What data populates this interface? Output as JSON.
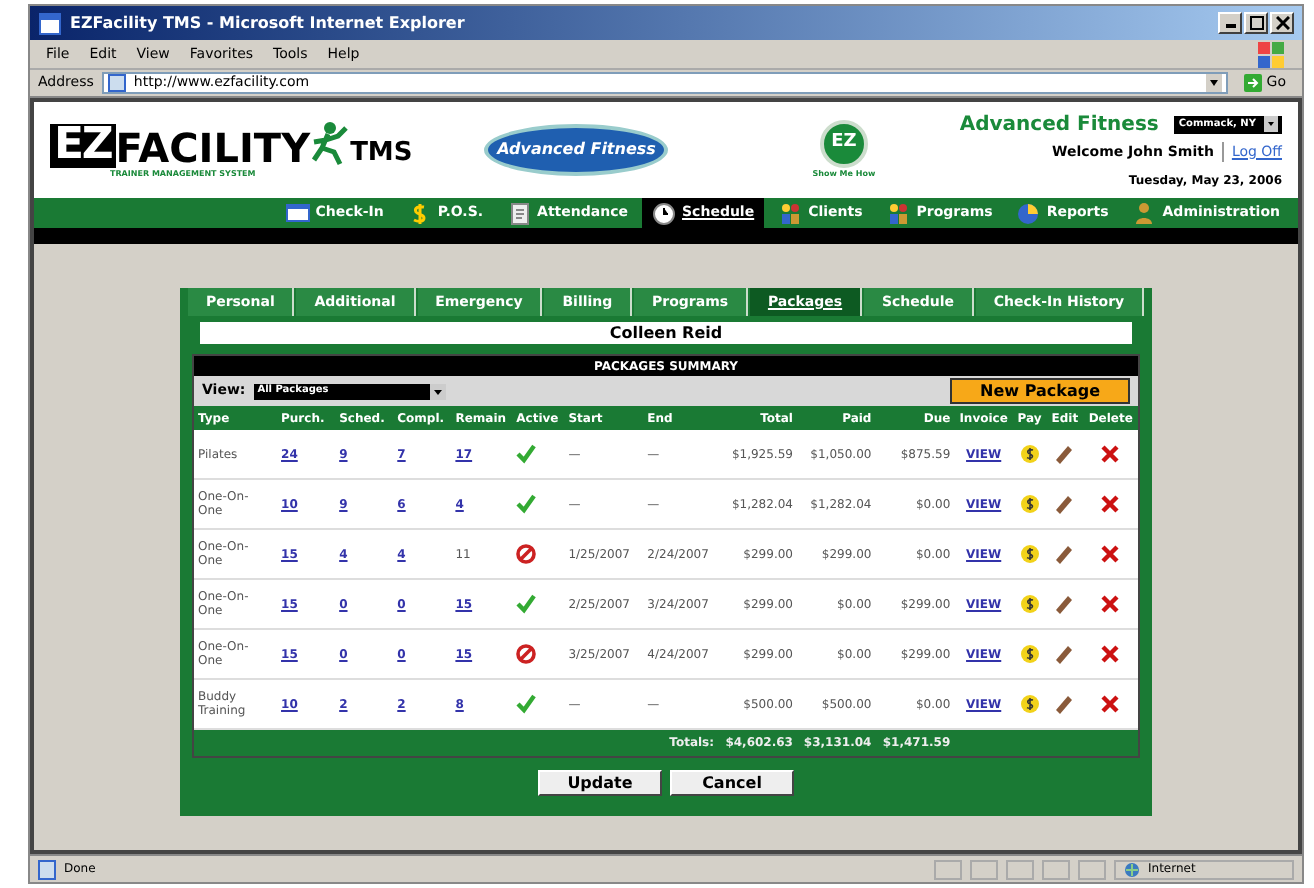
{
  "window": {
    "title": "EZFacility TMS - Microsoft Internet Explorer"
  },
  "menu": [
    "File",
    "Edit",
    "View",
    "Favorites",
    "Tools",
    "Help"
  ],
  "address": {
    "label": "Address",
    "value": "http://www.ezfacility.com",
    "go": "Go"
  },
  "header": {
    "logo_main": "FACILITY",
    "logo_letters": "EZ",
    "logo_suffix": "TMS",
    "logo_tagline": "TRAINER MANAGEMENT SYSTEM",
    "partner_logo": "Advanced Fitness",
    "help_badge": "EZ",
    "help_label": "Show Me How",
    "club": "Advanced Fitness",
    "location": "Commack, NY",
    "welcome": "Welcome John Smith",
    "logoff": "Log Off",
    "date": "Tuesday, May 23, 2006"
  },
  "nav": [
    {
      "label": "Check-In",
      "selected": false
    },
    {
      "label": "P.O.S.",
      "selected": false
    },
    {
      "label": "Attendance",
      "selected": false
    },
    {
      "label": "Schedule",
      "selected": true
    },
    {
      "label": "Clients",
      "selected": false
    },
    {
      "label": "Programs",
      "selected": false
    },
    {
      "label": "Reports",
      "selected": false
    },
    {
      "label": "Administration",
      "selected": false
    }
  ],
  "tabs": [
    {
      "label": "Personal",
      "selected": false
    },
    {
      "label": "Additional",
      "selected": false
    },
    {
      "label": "Emergency",
      "selected": false
    },
    {
      "label": "Billing",
      "selected": false
    },
    {
      "label": "Programs",
      "selected": false
    },
    {
      "label": "Packages",
      "selected": true
    },
    {
      "label": "Schedule",
      "selected": false
    },
    {
      "label": "Check-In History",
      "selected": false
    }
  ],
  "client_name": "Colleen Reid",
  "summary": {
    "title": "PACKAGES SUMMARY",
    "view_label": "View:",
    "view_value": "All Packages",
    "new_button": "New Package",
    "columns": [
      "Type",
      "Purch.",
      "Sched.",
      "Compl.",
      "Remain",
      "Active",
      "Start",
      "End",
      "Total",
      "Paid",
      "Due",
      "Invoice",
      "Pay",
      "Edit",
      "Delete"
    ],
    "rows": [
      {
        "type": "Pilates",
        "purch": "24",
        "sched": "9",
        "compl": "7",
        "remain": "17",
        "remain_link": true,
        "active": true,
        "start": "—",
        "end": "—",
        "total": "$1,925.59",
        "paid": "$1,050.00",
        "due": "$875.59",
        "invoice": "VIEW"
      },
      {
        "type": "One-On-One",
        "purch": "10",
        "sched": "9",
        "compl": "6",
        "remain": "4",
        "remain_link": true,
        "active": true,
        "start": "—",
        "end": "—",
        "total": "$1,282.04",
        "paid": "$1,282.04",
        "due": "$0.00",
        "invoice": "VIEW"
      },
      {
        "type": "One-On-One",
        "purch": "15",
        "sched": "4",
        "compl": "4",
        "remain": "11",
        "remain_link": false,
        "active": false,
        "start": "1/25/2007",
        "end": "2/24/2007",
        "total": "$299.00",
        "paid": "$299.00",
        "due": "$0.00",
        "invoice": "VIEW"
      },
      {
        "type": "One-On-One",
        "purch": "15",
        "sched": "0",
        "compl": "0",
        "remain": "15",
        "remain_link": true,
        "active": true,
        "start": "2/25/2007",
        "end": "3/24/2007",
        "total": "$299.00",
        "paid": "$0.00",
        "due": "$299.00",
        "invoice": "VIEW"
      },
      {
        "type": "One-On-One",
        "purch": "15",
        "sched": "0",
        "compl": "0",
        "remain": "15",
        "remain_link": true,
        "active": false,
        "start": "3/25/2007",
        "end": "4/24/2007",
        "total": "$299.00",
        "paid": "$0.00",
        "due": "$299.00",
        "invoice": "VIEW"
      },
      {
        "type": "Buddy Training",
        "purch": "10",
        "sched": "2",
        "compl": "2",
        "remain": "8",
        "remain_link": true,
        "active": true,
        "start": "—",
        "end": "—",
        "total": "$500.00",
        "paid": "$500.00",
        "due": "$0.00",
        "invoice": "VIEW"
      }
    ],
    "totals": {
      "label": "Totals:",
      "total": "$4,602.63",
      "paid": "$3,131.04",
      "due": "$1,471.59"
    }
  },
  "buttons": [
    "Update",
    "Cancel"
  ],
  "status_bar": {
    "text": "Done",
    "zone": "Internet"
  }
}
